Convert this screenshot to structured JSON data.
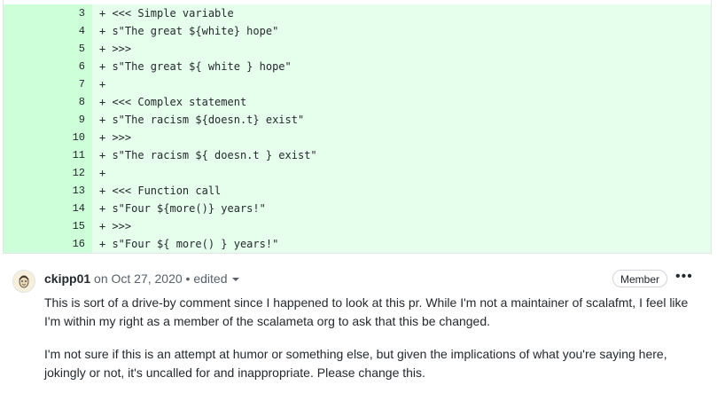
{
  "diff": {
    "lines": [
      {
        "num": "3",
        "code": "+ <<< Simple variable"
      },
      {
        "num": "4",
        "code": "+ s\"The great ${white} hope\""
      },
      {
        "num": "5",
        "code": "+ >>>"
      },
      {
        "num": "6",
        "code": "+ s\"The great ${ white } hope\""
      },
      {
        "num": "7",
        "code": "+"
      },
      {
        "num": "8",
        "code": "+ <<< Complex statement"
      },
      {
        "num": "9",
        "code": "+ s\"The racism ${doesn.t} exist\""
      },
      {
        "num": "10",
        "code": "+ >>>"
      },
      {
        "num": "11",
        "code": "+ s\"The racism ${ doesn.t } exist\""
      },
      {
        "num": "12",
        "code": "+"
      },
      {
        "num": "13",
        "code": "+ <<< Function call"
      },
      {
        "num": "14",
        "code": "+ s\"Four ${more()} years!\""
      },
      {
        "num": "15",
        "code": "+ >>>"
      },
      {
        "num": "16",
        "code": "+ s\"Four ${ more() } years!\""
      }
    ],
    "colors": {
      "added_line": "#e6ffec",
      "added_num": "#cdffd8"
    }
  },
  "comment": {
    "author": "ckipp01",
    "meta": "on Oct 27, 2020 • edited",
    "badge": "Member",
    "menu": "•••",
    "paragraphs": [
      "This is sort of a drive-by comment since I happened to look at this pr. While I'm not a maintainer of scalafmt, I feel like I'm within my right as a member of the scalameta org to ask that this be changed.",
      "I'm not sure if this is an attempt at humor or something else, but given the implications of what you're saying here, jokingly or not, it's uncalled for and inappropriate. Please change this."
    ],
    "avatar_icon": "user-avatar-icon"
  }
}
